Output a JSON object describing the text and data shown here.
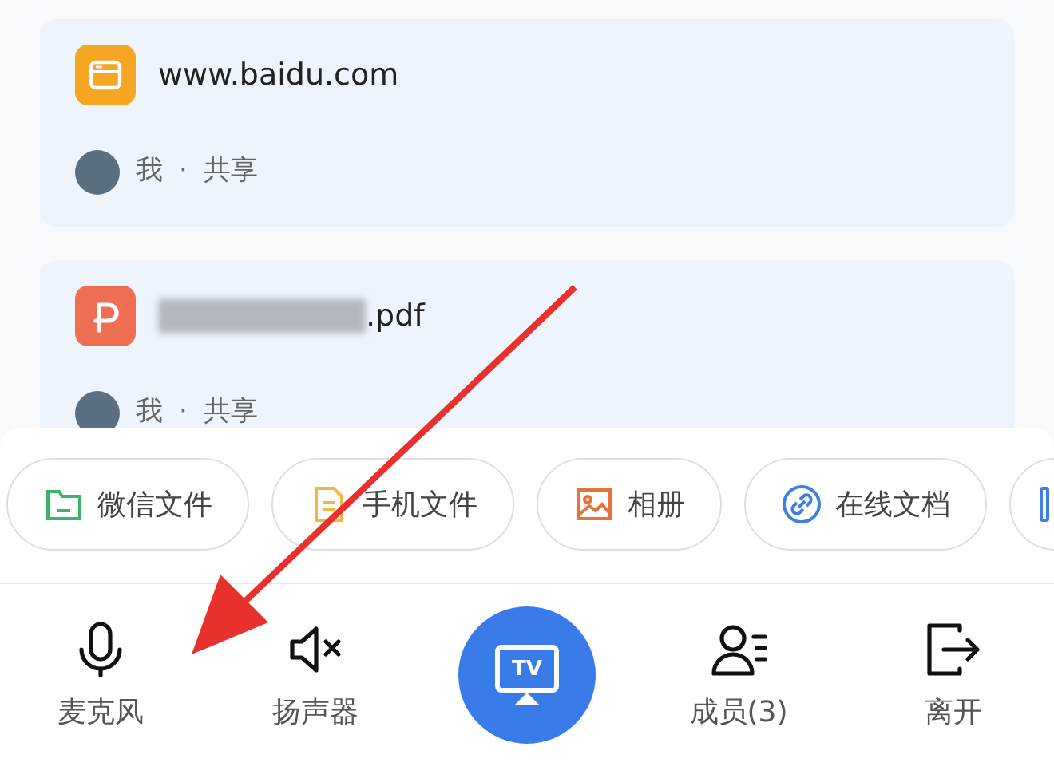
{
  "shared_items": [
    {
      "kind": "web",
      "title": "www.baidu.com",
      "owner": "我",
      "separator": "·",
      "action": "共享"
    },
    {
      "kind": "pdf",
      "title": ".pdf",
      "owner": "我",
      "separator": "·",
      "action": "共享"
    }
  ],
  "sources": [
    {
      "kind": "folder",
      "label": "微信文件"
    },
    {
      "kind": "file",
      "label": "手机文件"
    },
    {
      "kind": "image",
      "label": "相册"
    },
    {
      "kind": "link",
      "label": "在线文档"
    },
    {
      "kind": "cut"
    }
  ],
  "toolbar": [
    {
      "kind": "mic",
      "label": "麦克风"
    },
    {
      "kind": "speaker-muted",
      "label": "扬声器"
    },
    {
      "kind": "cast",
      "label": "TV"
    },
    {
      "kind": "members",
      "label": "成员(3)"
    },
    {
      "kind": "leave",
      "label": "离开"
    }
  ]
}
